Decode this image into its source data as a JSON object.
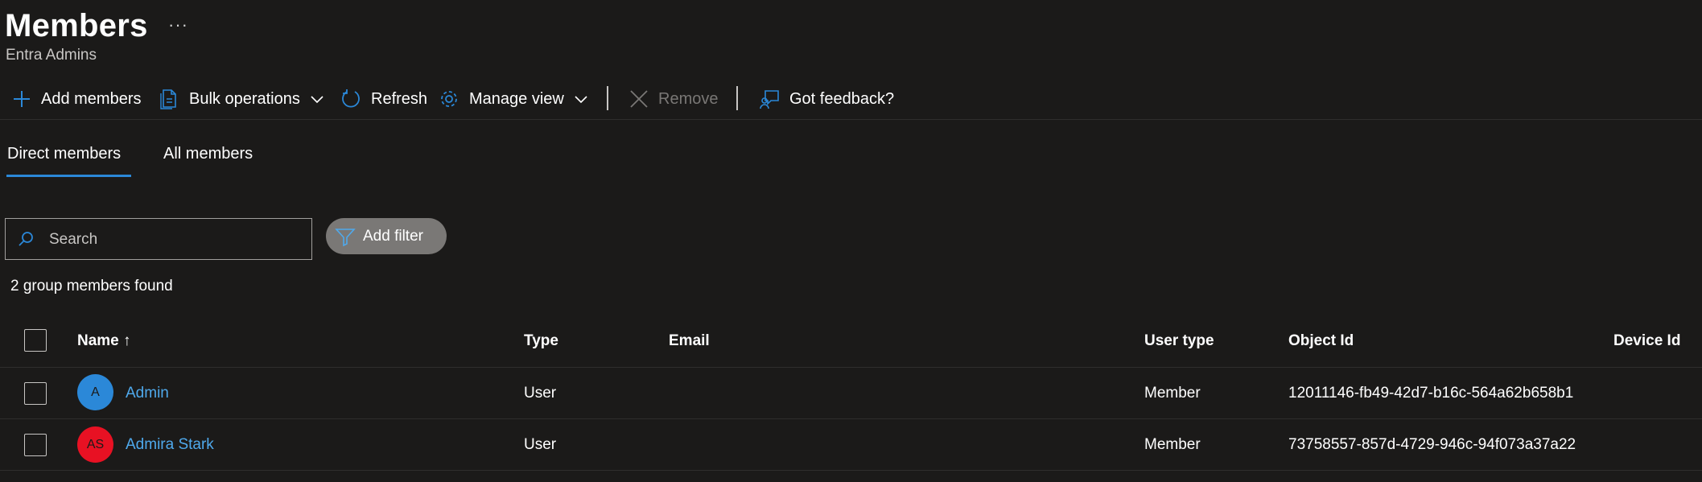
{
  "header": {
    "title": "Members",
    "more_label": "···",
    "subtitle": "Entra Admins"
  },
  "toolbar": {
    "add_members": "Add members",
    "bulk_operations": "Bulk operations",
    "refresh": "Refresh",
    "manage_view": "Manage view",
    "remove": "Remove",
    "feedback": "Got feedback?"
  },
  "tabs": [
    {
      "label": "Direct members",
      "selected": true
    },
    {
      "label": "All members",
      "selected": false
    }
  ],
  "search": {
    "placeholder": "Search",
    "value": ""
  },
  "filter": {
    "label": "Add filter"
  },
  "results_count": "2 group members found",
  "table": {
    "columns": [
      "Name ↑",
      "Type",
      "Email",
      "User type",
      "Object Id",
      "Device Id"
    ],
    "rows": [
      {
        "initials": "A",
        "avatar_color": "#2b88d8",
        "name": "Admin",
        "type": "User",
        "email": "",
        "user_type": "Member",
        "object_id": "12011146-fb49-42d7-b16c-564a62b658b1",
        "device_id": ""
      },
      {
        "initials": "AS",
        "avatar_color": "#e81123",
        "name": "Admira Stark",
        "type": "User",
        "email": "",
        "user_type": "Member",
        "object_id": "73758557-857d-4729-946c-94f073a37a22",
        "device_id": ""
      }
    ]
  },
  "colors": {
    "accent": "#2b88d8",
    "link": "#4fa9ec",
    "background": "#1b1a19"
  }
}
